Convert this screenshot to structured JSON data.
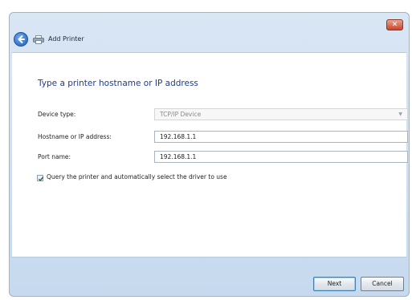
{
  "window": {
    "title": "Add Printer",
    "close_glyph": "✕"
  },
  "main": {
    "heading": "Type a printer hostname or IP address",
    "device_type": {
      "label": "Device type:",
      "value": "TCP/IP Device"
    },
    "hostname": {
      "label": "Hostname or IP address:",
      "value": "192.168.1.1"
    },
    "port_name": {
      "label": "Port name:",
      "value": "192.168.1.1"
    },
    "query_checkbox": {
      "label": "Query the printer and automatically select the driver to use",
      "checked": true
    }
  },
  "footer": {
    "next_label": "Next",
    "cancel_label": "Cancel"
  },
  "icons": [
    "back-arrow-icon",
    "printer-icon",
    "close-icon",
    "dropdown-arrow-icon",
    "checkmark-icon"
  ],
  "colors": {
    "heading": "#1f3b8c",
    "close_button": "#c9452c",
    "back_button": "#1f5fbf"
  }
}
